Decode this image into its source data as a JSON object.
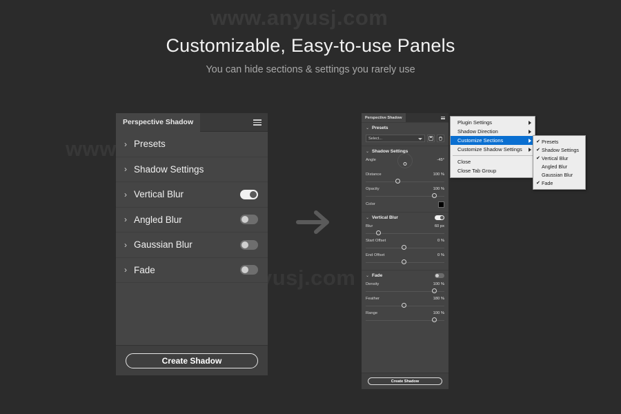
{
  "watermark": {
    "text": "www.anyusj.com"
  },
  "header": {
    "title": "Customizable, Easy-to-use Panels",
    "subtitle": "You can hide sections & settings you rarely use"
  },
  "arrow": {
    "icon": "arrow-right-icon"
  },
  "left_panel": {
    "tab_label": "Perspective Shadow",
    "menu_icon": "hamburger-menu-icon",
    "sections": [
      {
        "label": "Presets",
        "chevron": "›",
        "toggle": null
      },
      {
        "label": "Shadow Settings",
        "chevron": "›",
        "toggle": null
      },
      {
        "label": "Vertical Blur",
        "chevron": "›",
        "toggle": "on"
      },
      {
        "label": "Angled Blur",
        "chevron": "›",
        "toggle": "off"
      },
      {
        "label": "Gaussian Blur",
        "chevron": "›",
        "toggle": "off"
      },
      {
        "label": "Fade",
        "chevron": "›",
        "toggle": "off"
      }
    ],
    "create_button": "Create Shadow"
  },
  "right_panel": {
    "tab_label": "Perspective Shadow",
    "menu_icon": "hamburger-menu-icon",
    "presets": {
      "title": "Presets",
      "chevron": "⌄",
      "select_value": "Select...",
      "save_icon": "save-disk-icon",
      "delete_icon": "trash-icon"
    },
    "shadow_settings": {
      "title": "Shadow Settings",
      "chevron": "⌄",
      "controls": [
        {
          "name": "Angle",
          "value": "-45°",
          "type": "dial"
        },
        {
          "name": "Distance",
          "value": "100 %",
          "type": "slider",
          "pos": 38
        },
        {
          "name": "Opacity",
          "value": "100 %",
          "type": "slider",
          "pos": 84
        },
        {
          "name": "Color",
          "value": "",
          "type": "swatch",
          "color": "#000000"
        }
      ]
    },
    "vertical_blur": {
      "title": "Vertical Blur",
      "chevron": "⌄",
      "toggle": "on",
      "controls": [
        {
          "name": "Blur",
          "value": "60 px",
          "type": "slider",
          "pos": 13
        },
        {
          "name": "Start Offset",
          "value": "0 %",
          "type": "slider",
          "pos": 46
        },
        {
          "name": "End Offset",
          "value": "0 %",
          "type": "slider",
          "pos": 46
        }
      ]
    },
    "fade": {
      "title": "Fade",
      "chevron": "⌄",
      "toggle": "off",
      "controls": [
        {
          "name": "Density",
          "value": "100 %",
          "type": "slider",
          "pos": 84
        },
        {
          "name": "Feather",
          "value": "180 %",
          "type": "slider",
          "pos": 46
        },
        {
          "name": "Range",
          "value": "100 %",
          "type": "slider",
          "pos": 84
        }
      ]
    },
    "create_button": "Create Shadow"
  },
  "context_menu": {
    "items": [
      {
        "label": "Plugin Settings",
        "arrow": true,
        "selected": false
      },
      {
        "label": "Shadow Direction",
        "arrow": true,
        "selected": false
      },
      {
        "label": "Customize Sections",
        "arrow": true,
        "selected": true
      },
      {
        "label": "Customize Shadow Settings",
        "arrow": true,
        "selected": false
      },
      {
        "label": "Close",
        "arrow": false,
        "selected": false
      },
      {
        "label": "Close Tab Group",
        "arrow": false,
        "selected": false
      }
    ],
    "separator_after_index": 3
  },
  "submenu": {
    "items": [
      {
        "label": "Presets",
        "checked": true
      },
      {
        "label": "Shadow Settings",
        "checked": true
      },
      {
        "label": "Vertical Blur",
        "checked": true
      },
      {
        "label": "Angled Blur",
        "checked": false
      },
      {
        "label": "Gaussian Blur",
        "checked": false
      },
      {
        "label": "Fade",
        "checked": true
      }
    ],
    "check_glyph": "✔"
  },
  "colors": {
    "background": "#2b2b2b",
    "panel": "#454545",
    "accent_selection": "#0a6fd1",
    "menu_bg": "#ededed",
    "text_primary": "#f0f0f0"
  }
}
